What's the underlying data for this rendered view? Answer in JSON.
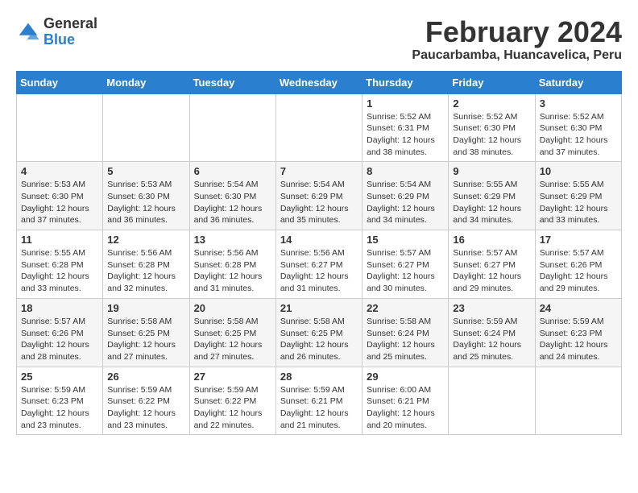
{
  "header": {
    "logo_general": "General",
    "logo_blue": "Blue",
    "title": "February 2024",
    "subtitle": "Paucarbamba, Huancavelica, Peru"
  },
  "weekdays": [
    "Sunday",
    "Monday",
    "Tuesday",
    "Wednesday",
    "Thursday",
    "Friday",
    "Saturday"
  ],
  "weeks": [
    [
      {
        "day": "",
        "info": ""
      },
      {
        "day": "",
        "info": ""
      },
      {
        "day": "",
        "info": ""
      },
      {
        "day": "",
        "info": ""
      },
      {
        "day": "1",
        "info": "Sunrise: 5:52 AM\nSunset: 6:31 PM\nDaylight: 12 hours\nand 38 minutes."
      },
      {
        "day": "2",
        "info": "Sunrise: 5:52 AM\nSunset: 6:30 PM\nDaylight: 12 hours\nand 38 minutes."
      },
      {
        "day": "3",
        "info": "Sunrise: 5:52 AM\nSunset: 6:30 PM\nDaylight: 12 hours\nand 37 minutes."
      }
    ],
    [
      {
        "day": "4",
        "info": "Sunrise: 5:53 AM\nSunset: 6:30 PM\nDaylight: 12 hours\nand 37 minutes."
      },
      {
        "day": "5",
        "info": "Sunrise: 5:53 AM\nSunset: 6:30 PM\nDaylight: 12 hours\nand 36 minutes."
      },
      {
        "day": "6",
        "info": "Sunrise: 5:54 AM\nSunset: 6:30 PM\nDaylight: 12 hours\nand 36 minutes."
      },
      {
        "day": "7",
        "info": "Sunrise: 5:54 AM\nSunset: 6:29 PM\nDaylight: 12 hours\nand 35 minutes."
      },
      {
        "day": "8",
        "info": "Sunrise: 5:54 AM\nSunset: 6:29 PM\nDaylight: 12 hours\nand 34 minutes."
      },
      {
        "day": "9",
        "info": "Sunrise: 5:55 AM\nSunset: 6:29 PM\nDaylight: 12 hours\nand 34 minutes."
      },
      {
        "day": "10",
        "info": "Sunrise: 5:55 AM\nSunset: 6:29 PM\nDaylight: 12 hours\nand 33 minutes."
      }
    ],
    [
      {
        "day": "11",
        "info": "Sunrise: 5:55 AM\nSunset: 6:28 PM\nDaylight: 12 hours\nand 33 minutes."
      },
      {
        "day": "12",
        "info": "Sunrise: 5:56 AM\nSunset: 6:28 PM\nDaylight: 12 hours\nand 32 minutes."
      },
      {
        "day": "13",
        "info": "Sunrise: 5:56 AM\nSunset: 6:28 PM\nDaylight: 12 hours\nand 31 minutes."
      },
      {
        "day": "14",
        "info": "Sunrise: 5:56 AM\nSunset: 6:27 PM\nDaylight: 12 hours\nand 31 minutes."
      },
      {
        "day": "15",
        "info": "Sunrise: 5:57 AM\nSunset: 6:27 PM\nDaylight: 12 hours\nand 30 minutes."
      },
      {
        "day": "16",
        "info": "Sunrise: 5:57 AM\nSunset: 6:27 PM\nDaylight: 12 hours\nand 29 minutes."
      },
      {
        "day": "17",
        "info": "Sunrise: 5:57 AM\nSunset: 6:26 PM\nDaylight: 12 hours\nand 29 minutes."
      }
    ],
    [
      {
        "day": "18",
        "info": "Sunrise: 5:57 AM\nSunset: 6:26 PM\nDaylight: 12 hours\nand 28 minutes."
      },
      {
        "day": "19",
        "info": "Sunrise: 5:58 AM\nSunset: 6:25 PM\nDaylight: 12 hours\nand 27 minutes."
      },
      {
        "day": "20",
        "info": "Sunrise: 5:58 AM\nSunset: 6:25 PM\nDaylight: 12 hours\nand 27 minutes."
      },
      {
        "day": "21",
        "info": "Sunrise: 5:58 AM\nSunset: 6:25 PM\nDaylight: 12 hours\nand 26 minutes."
      },
      {
        "day": "22",
        "info": "Sunrise: 5:58 AM\nSunset: 6:24 PM\nDaylight: 12 hours\nand 25 minutes."
      },
      {
        "day": "23",
        "info": "Sunrise: 5:59 AM\nSunset: 6:24 PM\nDaylight: 12 hours\nand 25 minutes."
      },
      {
        "day": "24",
        "info": "Sunrise: 5:59 AM\nSunset: 6:23 PM\nDaylight: 12 hours\nand 24 minutes."
      }
    ],
    [
      {
        "day": "25",
        "info": "Sunrise: 5:59 AM\nSunset: 6:23 PM\nDaylight: 12 hours\nand 23 minutes."
      },
      {
        "day": "26",
        "info": "Sunrise: 5:59 AM\nSunset: 6:22 PM\nDaylight: 12 hours\nand 23 minutes."
      },
      {
        "day": "27",
        "info": "Sunrise: 5:59 AM\nSunset: 6:22 PM\nDaylight: 12 hours\nand 22 minutes."
      },
      {
        "day": "28",
        "info": "Sunrise: 5:59 AM\nSunset: 6:21 PM\nDaylight: 12 hours\nand 21 minutes."
      },
      {
        "day": "29",
        "info": "Sunrise: 6:00 AM\nSunset: 6:21 PM\nDaylight: 12 hours\nand 20 minutes."
      },
      {
        "day": "",
        "info": ""
      },
      {
        "day": "",
        "info": ""
      }
    ]
  ]
}
